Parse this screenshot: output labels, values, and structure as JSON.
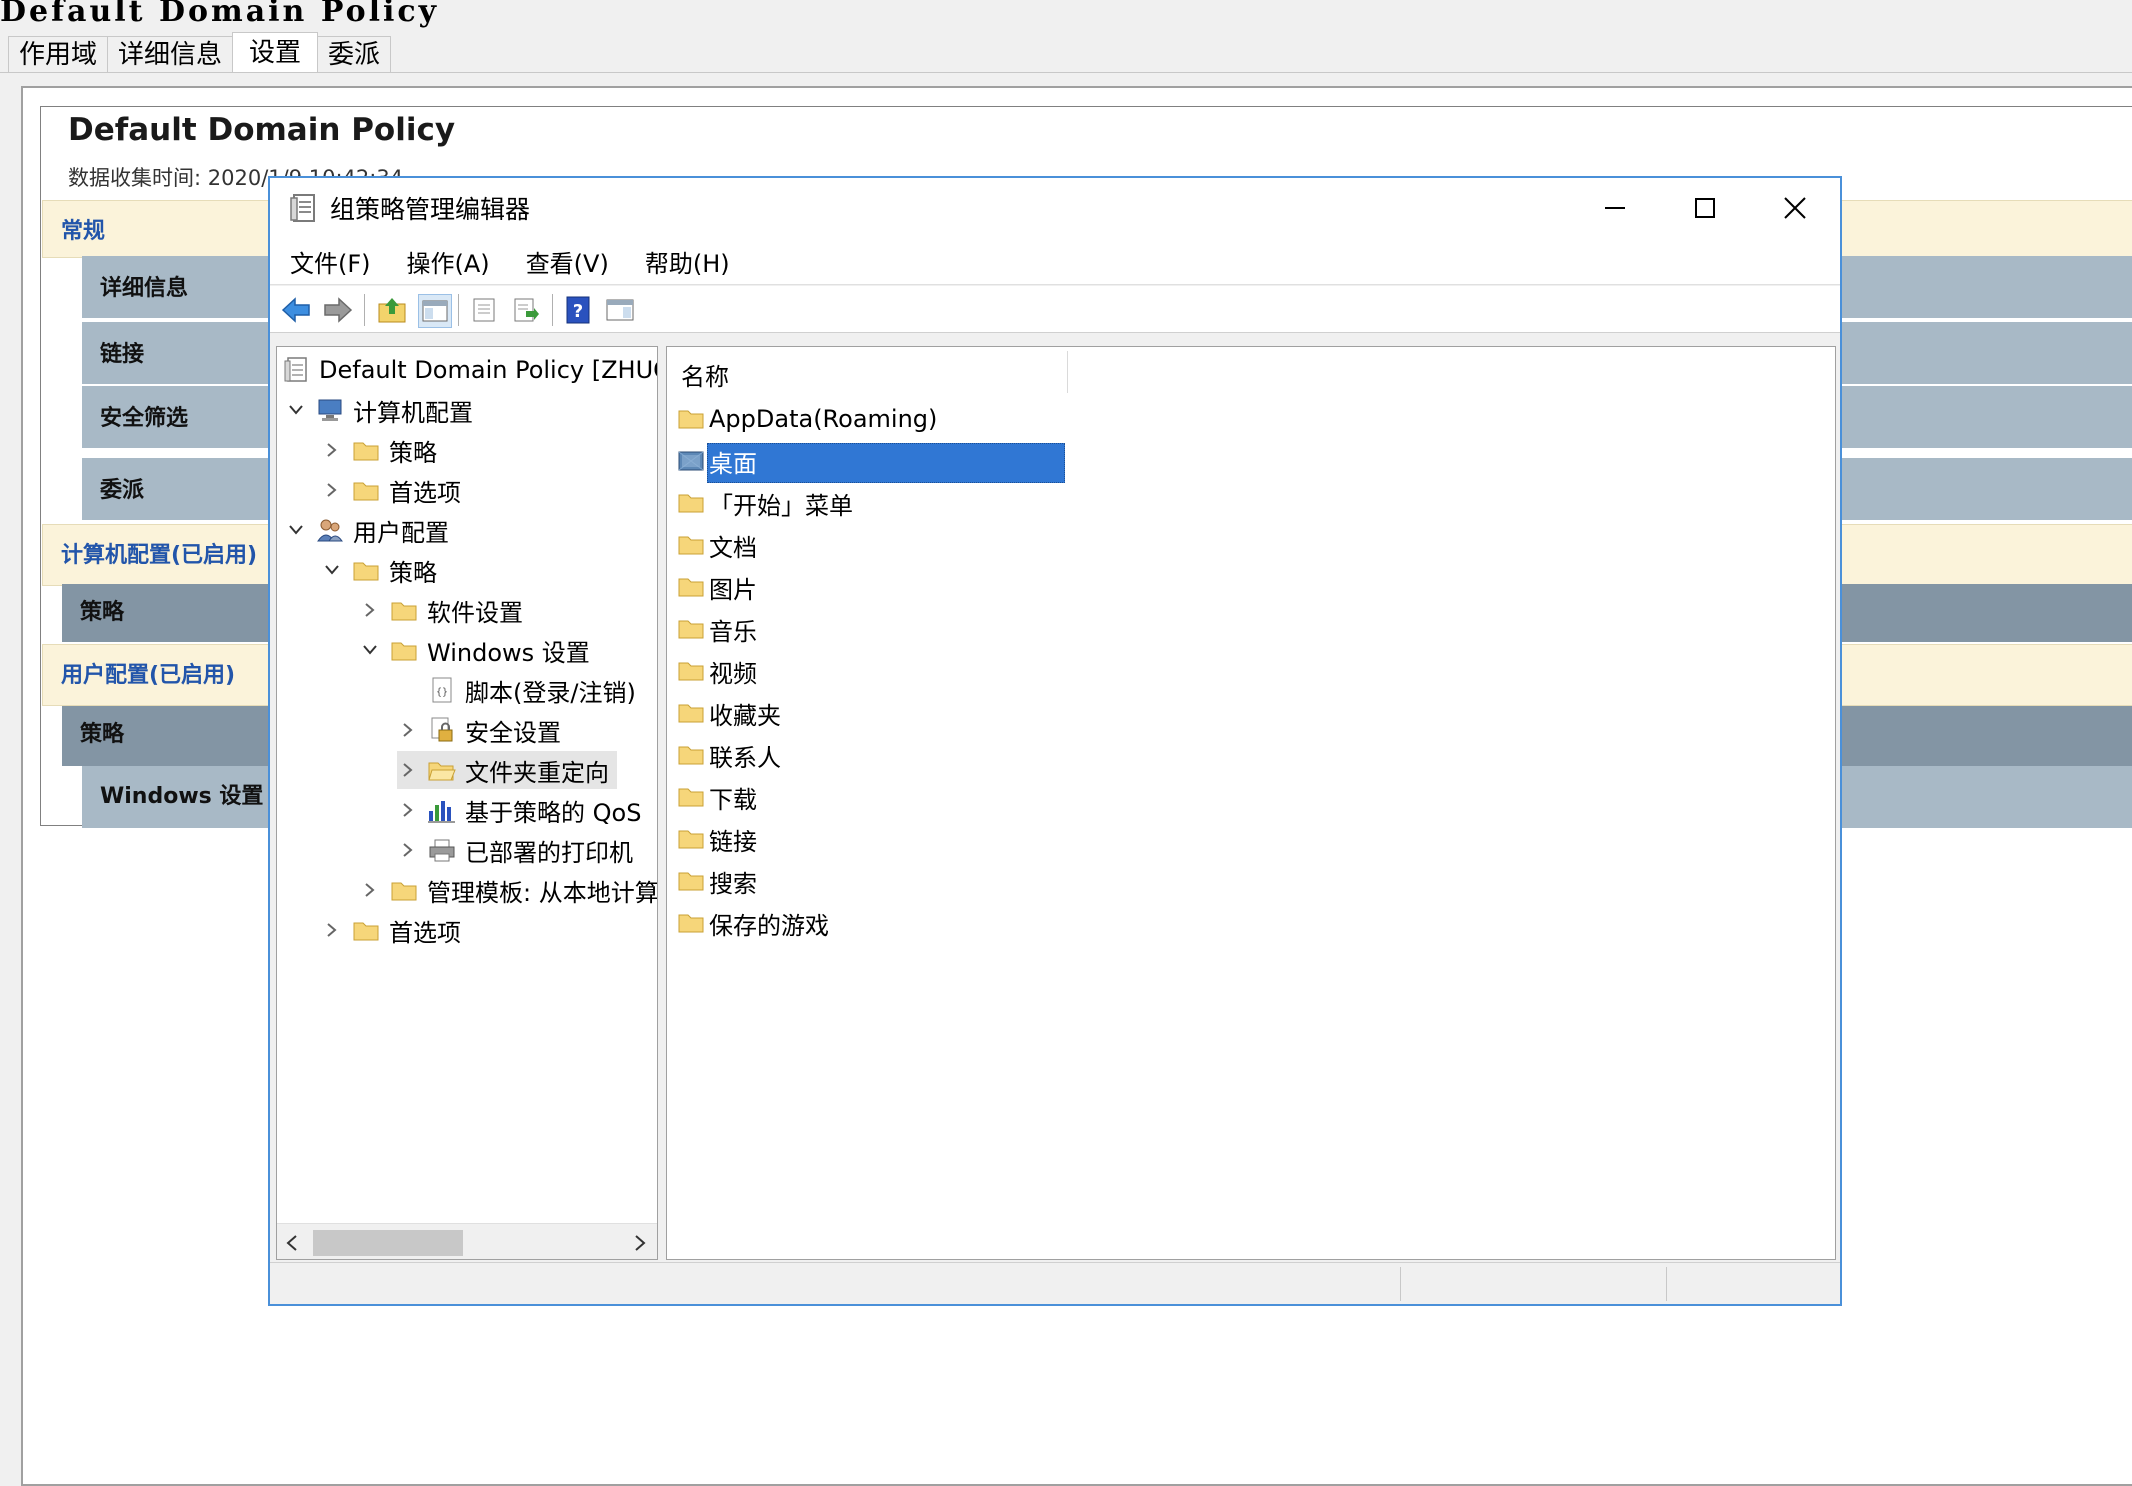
{
  "report": {
    "title_mono": "Default Domain Policy",
    "tabs": [
      "作用域",
      "详细信息",
      "设置",
      "委派"
    ],
    "heading": "Default Domain Policy",
    "collected": "数据收集时间: 2020/1/9 10:42:34",
    "sections": {
      "general": "常规",
      "details": "详细信息",
      "links": "链接",
      "security_filter": "安全筛选",
      "delegation": "委派",
      "computer_config": "计算机配置(已启用)",
      "computer_policies": "策略",
      "user_config": "用户配置(已启用)",
      "user_policies": "策略",
      "windows_settings": "Windows 设置"
    }
  },
  "window": {
    "title": "组策略管理编辑器",
    "menu": [
      "文件(F)",
      "操作(A)",
      "查看(V)",
      "帮助(H)"
    ]
  },
  "tree": {
    "root": "Default Domain Policy [ZHUGE",
    "computer_config": "计算机配置",
    "cc_policies": "策略",
    "cc_preferences": "首选项",
    "user_config": "用户配置",
    "uc_policies": "策略",
    "software_settings": "软件设置",
    "windows_settings": "Windows 设置",
    "scripts": "脚本(登录/注销)",
    "security_settings": "安全设置",
    "folder_redirection": "文件夹重定向",
    "qos": "基于策略的 QoS",
    "printers": "已部署的打印机",
    "admin_templates": "管理模板: 从本地计算",
    "uc_preferences": "首选项"
  },
  "list": {
    "column": "名称",
    "items": [
      "AppData(Roaming)",
      "桌面",
      "「开始」菜单",
      "文档",
      "图片",
      "音乐",
      "视频",
      "收藏夹",
      "联系人",
      "下载",
      "链接",
      "搜索",
      "保存的游戏"
    ],
    "selected": "桌面"
  }
}
